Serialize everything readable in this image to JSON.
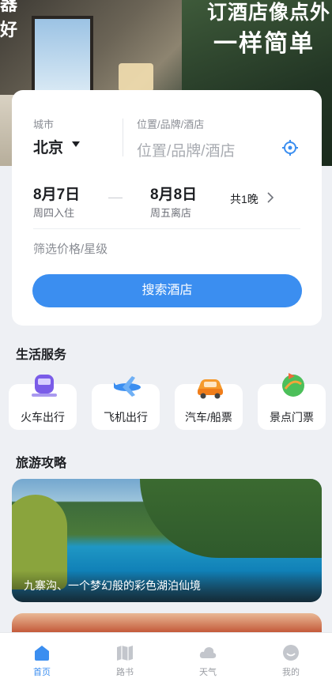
{
  "hero": {
    "slogan_line1": "订酒店像点外",
    "slogan_line2": "一样简单",
    "partial_text_top": "器",
    "partial_text": "好"
  },
  "search_card": {
    "city_label": "城市",
    "city_value": "北京",
    "keyword_label": "位置/品牌/酒店",
    "keyword_placeholder": "位置/品牌/酒店",
    "checkin_date": "8月7日",
    "checkin_sub": "周四入住",
    "checkout_date": "8月8日",
    "checkout_sub": "周五离店",
    "nights": "共1晚",
    "filter_placeholder": "筛选价格/星级",
    "search_button": "搜索酒店",
    "accent_color": "#3b8ef0"
  },
  "life_services": {
    "title": "生活服务",
    "items": [
      {
        "label": "火车出行",
        "icon": "train-icon"
      },
      {
        "label": "飞机出行",
        "icon": "airplane-icon"
      },
      {
        "label": "汽车/船票",
        "icon": "car-icon"
      },
      {
        "label": "景点门票",
        "icon": "scenic-ticket-icon"
      }
    ]
  },
  "travel_guides": {
    "title": "旅游攻略",
    "items": [
      {
        "caption": "九寨沟、一个梦幻般的彩色湖泊仙境"
      }
    ]
  },
  "tabbar": {
    "items": [
      {
        "label": "首页",
        "icon": "home-icon",
        "active": true
      },
      {
        "label": "路书",
        "icon": "map-book-icon",
        "active": false
      },
      {
        "label": "天气",
        "icon": "weather-cloud-icon",
        "active": false
      },
      {
        "label": "我的",
        "icon": "profile-icon",
        "active": false
      }
    ]
  }
}
